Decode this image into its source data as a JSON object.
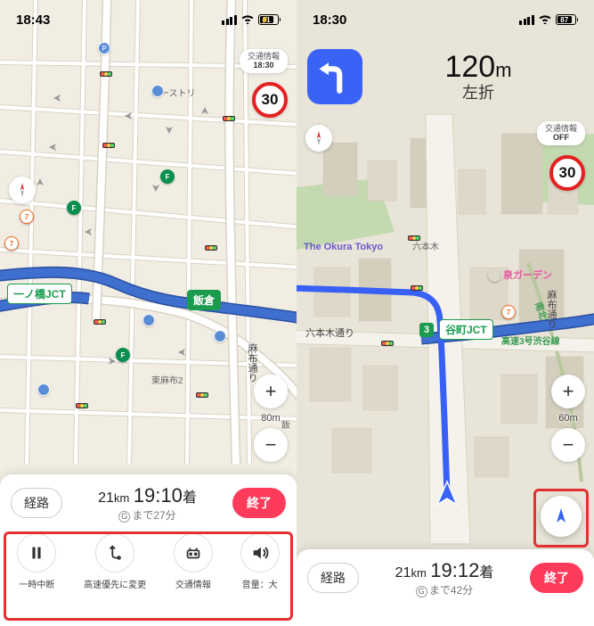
{
  "left": {
    "status": {
      "time": "18:43",
      "battery_pct": 81,
      "battery_label": "81"
    },
    "traffic_toggle": {
      "line1": "交通情報",
      "line2": "18:30"
    },
    "speed_limit": "30",
    "jct1": "一ノ橋JCT",
    "jct2": "飯倉",
    "area_label": "東麻布2",
    "road_v": "麻布通り",
    "poi_austria": "オーストリ",
    "poi_ii": "飯",
    "zoom_scale": "80m",
    "panel": {
      "route_label": "経路",
      "distance": "21",
      "distance_unit": "km",
      "eta_time": "19:10",
      "eta_suffix": "着",
      "remain_prefix": "まで",
      "remain": "27分",
      "end_label": "終了"
    },
    "quick": [
      {
        "label": "一時中断",
        "icon": "pause"
      },
      {
        "label": "高速優先に変更",
        "icon": "reroute"
      },
      {
        "label": "交通情報",
        "icon": "radio"
      },
      {
        "label": "音量：大",
        "icon": "vol"
      }
    ]
  },
  "right": {
    "status": {
      "time": "18:30",
      "battery_pct": 87,
      "battery_label": "87"
    },
    "banner": {
      "distance": "120",
      "unit": "m",
      "direction": "左折"
    },
    "traffic_toggle": {
      "line1": "交通情報",
      "line2": "OFF"
    },
    "speed_limit": "30",
    "poi_okura": "The Okura Tokyo",
    "poi_roppongi": "六本木",
    "poi_izumi": "泉ガーデン",
    "road_roppongi": "六本木通り",
    "jct": "谷町JCT",
    "route_no": "3",
    "hwy_name": "高速3号渋谷線",
    "road_azabu": "麻布通り",
    "zoom_scale": "60m",
    "panel": {
      "route_label": "経路",
      "distance": "21",
      "distance_unit": "km",
      "eta_time": "19:12",
      "eta_suffix": "着",
      "remain_prefix": "まで",
      "remain": "42分",
      "end_label": "終了"
    }
  },
  "colors": {
    "tl_r": "#ff5a4d",
    "tl_y": "#ffcf4d",
    "tl_g": "#52d96b"
  }
}
